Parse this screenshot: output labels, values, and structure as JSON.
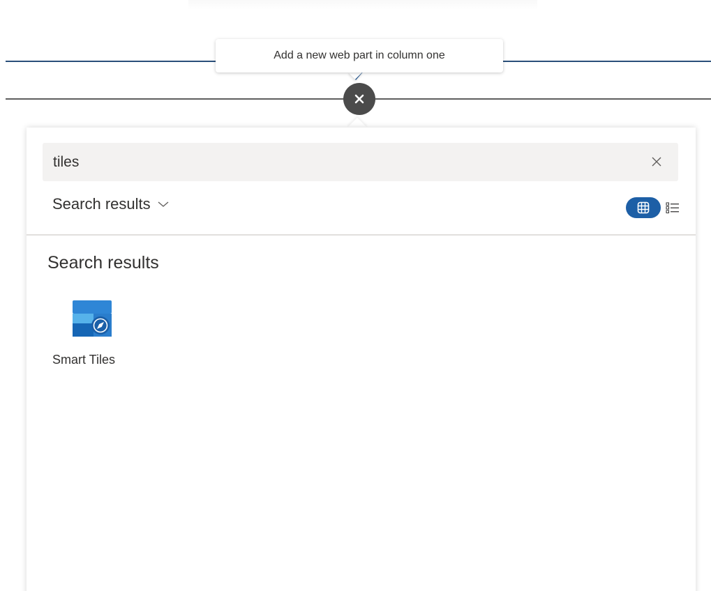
{
  "tooltip": {
    "text": "Add a new web part in column one"
  },
  "search": {
    "value": "tiles",
    "clear_icon": "close-icon"
  },
  "category": {
    "selected": "Search results",
    "icon": "chevron-down-icon"
  },
  "view_toggle": {
    "grid_icon": "grid-icon",
    "list_icon": "list-icon",
    "active": "grid"
  },
  "results": {
    "heading": "Search results",
    "items": [
      {
        "label": "Smart Tiles",
        "icon": "smart-tiles-icon"
      }
    ]
  },
  "colors": {
    "accent": "#1d5fa6",
    "section_line": "#2a4f7a",
    "close_button": "#4b4b4b",
    "search_background": "#f3f2f1",
    "text": "#323130"
  }
}
